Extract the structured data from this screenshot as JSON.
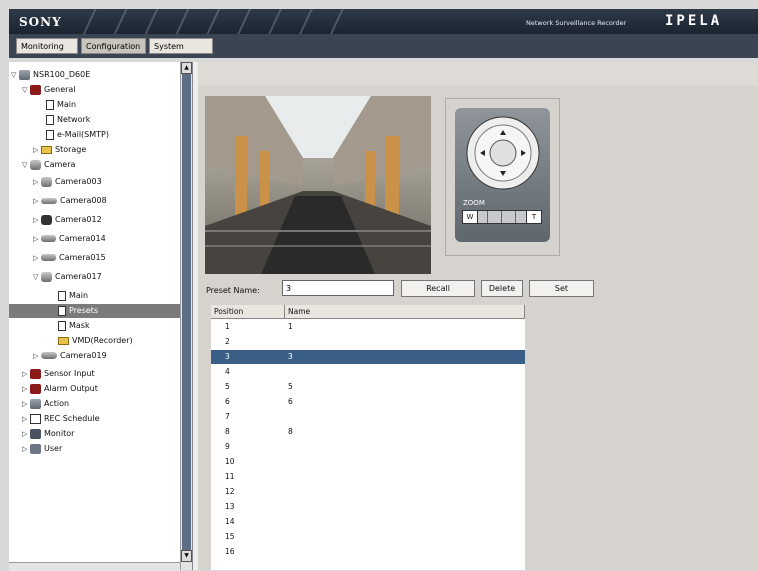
{
  "header": {
    "logo": "SONY",
    "product": "Network Surveillance Recorder",
    "brand": "IPELA"
  },
  "tabs": [
    {
      "label": "Monitoring"
    },
    {
      "label": "Configuration"
    },
    {
      "label": "System"
    }
  ],
  "tree": {
    "root": "NSR100_D60E",
    "general": {
      "label": "General",
      "items": [
        "Main",
        "Network",
        "e-Mail(SMTP)",
        "Storage"
      ]
    },
    "camera": {
      "label": "Camera",
      "cameras": [
        "Camera003",
        "Camera008",
        "Camera012",
        "Camera014",
        "Camera015",
        "Camera017",
        "Camera019"
      ]
    },
    "cam17_items": [
      "Main",
      "Presets",
      "Mask",
      "VMD(Recorder)"
    ],
    "others": [
      "Sensor Input",
      "Alarm Output",
      "Action",
      "REC Schedule",
      "Monitor",
      "User"
    ]
  },
  "ptz": {
    "zoom_label": "ZOOM",
    "wide": "W",
    "tele": "T"
  },
  "preset": {
    "label": "Preset Name:",
    "value": "3",
    "recall": "Recall",
    "delete": "Delete",
    "set": "Set"
  },
  "grid": {
    "col_position": "Position",
    "col_name": "Name",
    "rows": [
      {
        "pos": "1",
        "name": "1"
      },
      {
        "pos": "2",
        "name": ""
      },
      {
        "pos": "3",
        "name": "3"
      },
      {
        "pos": "4",
        "name": ""
      },
      {
        "pos": "5",
        "name": "5"
      },
      {
        "pos": "6",
        "name": "6"
      },
      {
        "pos": "7",
        "name": ""
      },
      {
        "pos": "8",
        "name": "8"
      },
      {
        "pos": "9",
        "name": ""
      },
      {
        "pos": "10",
        "name": ""
      },
      {
        "pos": "11",
        "name": ""
      },
      {
        "pos": "12",
        "name": ""
      },
      {
        "pos": "13",
        "name": ""
      },
      {
        "pos": "14",
        "name": ""
      },
      {
        "pos": "15",
        "name": ""
      },
      {
        "pos": "16",
        "name": ""
      }
    ]
  }
}
